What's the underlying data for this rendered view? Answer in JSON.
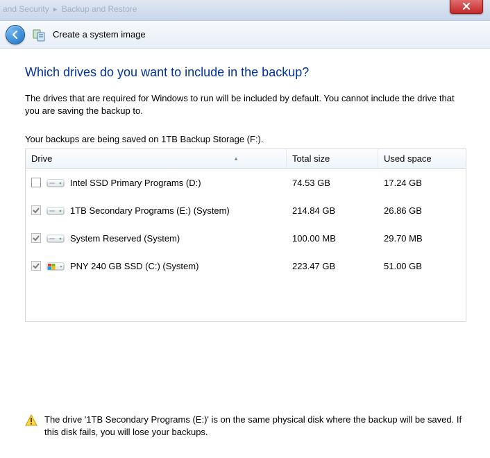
{
  "titlebar": {
    "breadcrumb_part1": "and Security",
    "breadcrumb_part2": "Backup and Restore"
  },
  "nav": {
    "title": "Create a system image"
  },
  "heading": "Which drives do you want to include in the backup?",
  "description": "The drives that are required for Windows to run will be included by default. You cannot include the drive that you are saving the backup to.",
  "save_location_line": "Your backups are being saved on 1TB Backup Storage (F:).",
  "table": {
    "headers": {
      "drive": "Drive",
      "total": "Total size",
      "used": "Used space"
    },
    "rows": [
      {
        "checked": false,
        "disabled": false,
        "has_logo": false,
        "name": "Intel SSD Primary Programs (D:)",
        "total": "74.53 GB",
        "used": "17.24 GB"
      },
      {
        "checked": true,
        "disabled": true,
        "has_logo": false,
        "name": "1TB Secondary Programs (E:) (System)",
        "total": "214.84 GB",
        "used": "26.86 GB"
      },
      {
        "checked": true,
        "disabled": true,
        "has_logo": false,
        "name": "System Reserved (System)",
        "total": "100.00 MB",
        "used": "29.70 MB"
      },
      {
        "checked": true,
        "disabled": true,
        "has_logo": true,
        "name": "PNY 240 GB SSD (C:) (System)",
        "total": "223.47 GB",
        "used": "51.00 GB"
      }
    ]
  },
  "warning": "The drive '1TB Secondary Programs (E:)' is on the same physical disk where the backup will be saved. If this disk fails, you will lose your backups."
}
